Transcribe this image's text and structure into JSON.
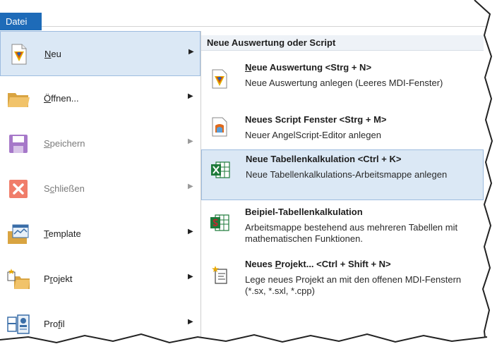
{
  "ribbon": {
    "file_tab": "Datei"
  },
  "left_menu": {
    "items": [
      {
        "label": "Neu",
        "underline": "N",
        "rest": "eu",
        "icon": "neu-icon",
        "enabled": true,
        "submenu": true,
        "active": true
      },
      {
        "label": "Öffnen...",
        "underline": "Ö",
        "rest": "ffnen...",
        "icon": "folder-open-icon",
        "enabled": true,
        "submenu": true
      },
      {
        "label": "Speichern",
        "underline": "S",
        "rest": "peichern",
        "icon": "save-icon",
        "enabled": false,
        "submenu": true
      },
      {
        "label": "Schließen",
        "underline": "c",
        "pre": "S",
        "rest": "hließen",
        "icon": "close-icon",
        "enabled": false,
        "submenu": true
      },
      {
        "label": "Template",
        "underline": "T",
        "rest": "emplate",
        "icon": "template-icon",
        "enabled": true,
        "submenu": true
      },
      {
        "label": "Projekt",
        "underline": "r",
        "pre": "P",
        "rest": "ojekt",
        "icon": "project-icon",
        "enabled": true,
        "submenu": true
      },
      {
        "label": "Profil",
        "underline": "f",
        "pre": "Pro",
        "rest": "il",
        "icon": "profile-icon",
        "enabled": true,
        "submenu": true
      }
    ]
  },
  "submenu": {
    "header": "Neue Auswertung oder Script",
    "items": [
      {
        "title": "Neue Auswertung  <Strg + N>",
        "title_u": "N",
        "title_rest": "eue Auswertung  <Strg + N>",
        "desc": "Neue Auswertung anlegen (Leeres MDI-Fenster)",
        "icon": "evaluation-icon"
      },
      {
        "title": "Neues Script Fenster  <Strg + M>",
        "desc": "Neuer AngelScript-Editor anlegen",
        "icon": "script-icon"
      },
      {
        "title": "Neue Tabellenkalkulation <Ctrl + K>",
        "desc": "Neue Tabellenkalkulations-Arbeitsmappe anlegen",
        "icon": "spreadsheet-icon",
        "active": true
      },
      {
        "title": "Beipiel-Tabellenkalkulation",
        "desc": "Arbeitsmappe bestehend aus mehreren Tabellen mit mathematischen Funktionen.",
        "icon": "sample-spreadsheet-icon"
      },
      {
        "title": "Neues Projekt... <Ctrl + Shift + N>",
        "title_pre": "Neues ",
        "title_u": "P",
        "title_rest": "rojekt... <Ctrl + Shift + N>",
        "desc": "Lege neues Projekt an mit den offenen MDI-Fenstern (*.sx, *.sxl, *.cpp)",
        "icon": "new-project-icon"
      }
    ]
  },
  "colors": {
    "accent": "#1e6bb8",
    "highlight": "#dbe8f5",
    "highlight_border": "#9dbce0",
    "excel_green": "#1d7a3a"
  }
}
